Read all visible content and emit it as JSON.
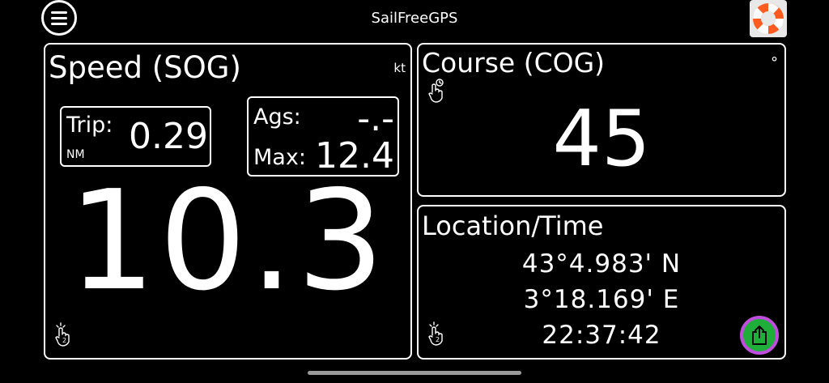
{
  "header": {
    "title": "SailFreeGPS",
    "menu_icon": "hamburger-menu-icon",
    "help_icon": "lifebuoy-icon"
  },
  "speed": {
    "title": "Speed (SOG)",
    "unit": "kt",
    "trip_label": "Trip:",
    "trip_value": "0.29",
    "trip_unit": "NM",
    "ags_label": "Ags:",
    "ags_value": "-.-",
    "max_label": "Max:",
    "max_value": "12.4",
    "value": "10.3",
    "gesture_icon": "two-finger-tap-icon"
  },
  "course": {
    "title": "Course (COG)",
    "unit": "°",
    "value": "45",
    "gesture_icon": "long-press-icon"
  },
  "location": {
    "title": "Location/Time",
    "lat": "43°4.983' N",
    "lon": "3°18.169' E",
    "time": "22:37:42",
    "gesture_icon": "two-finger-tap-icon",
    "share_icon": "share-icon"
  },
  "colors": {
    "background": "#000000",
    "foreground": "#ffffff",
    "share_fill": "#1fae3a",
    "share_ring": "#c14ddf"
  }
}
